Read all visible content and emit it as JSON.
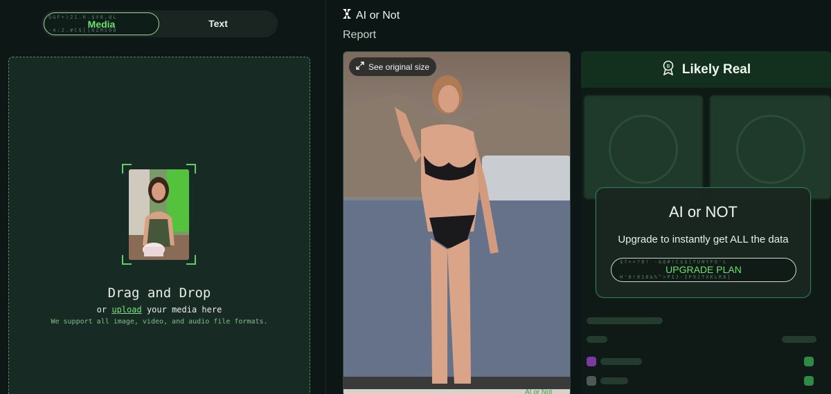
{
  "toggle": {
    "media_label": "Media",
    "text_label": "Text",
    "media_matrix_top": "Q&F+)21.K.$V8,@L",
    "media_matrix_bottom": "-4:2.#C$[]8ZMS00"
  },
  "dropzone": {
    "title": "Drag and Drop",
    "sub_prefix": "or ",
    "upload_link": "upload",
    "sub_suffix": " your media here",
    "note": "We support all image, video, and audio file formats."
  },
  "header": {
    "brand": "AI or Not",
    "section": "Report"
  },
  "preview": {
    "see_original_label": "See original size",
    "watermark": "AI or Not"
  },
  "result": {
    "verdict": "Likely Real"
  },
  "upgrade": {
    "title": "AI or NOT",
    "subtitle": "Upgrade to instantly get ALL the data",
    "button_label": "UPGRADE PLAN",
    "matrix_top": "$7++?8! -&@#!C$$[TUNYFO'L",
    "matrix_bottom": "H'0!018&%^>PIJ-IP9JTXKLR8]"
  },
  "colors": {
    "accent": "#6de36e",
    "background": "#0c1614",
    "panel": "#172a23",
    "verdict_bar": "#12301d"
  }
}
